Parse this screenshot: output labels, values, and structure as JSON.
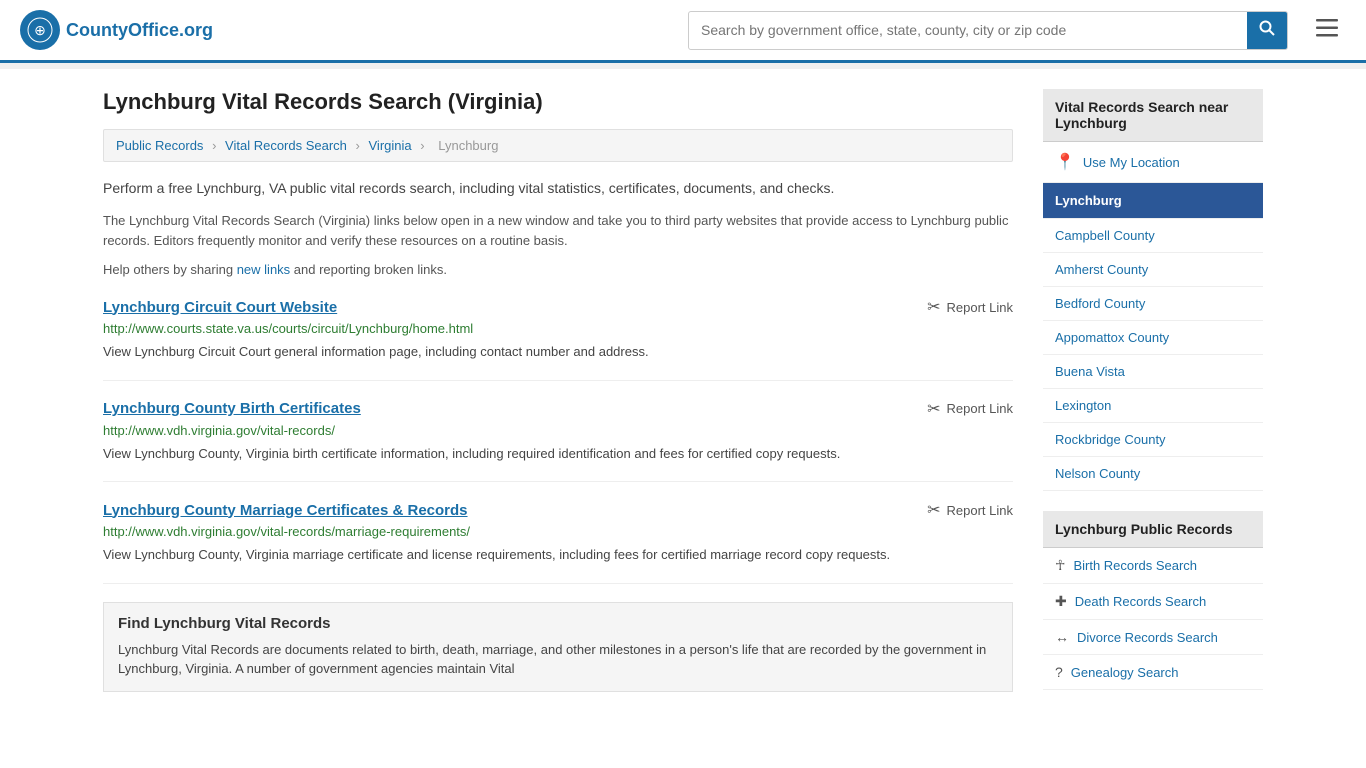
{
  "header": {
    "logo_text": "CountyOffice",
    "logo_org": ".org",
    "search_placeholder": "Search by government office, state, county, city or zip code"
  },
  "page": {
    "title": "Lynchburg Vital Records Search (Virginia)",
    "breadcrumb": {
      "items": [
        "Public Records",
        "Vital Records Search",
        "Virginia",
        "Lynchburg"
      ]
    },
    "intro": "Perform a free Lynchburg, VA public vital records search, including vital statistics, certificates, documents, and checks.",
    "disclaimer": "The Lynchburg Vital Records Search (Virginia) links below open in a new window and take you to third party websites that provide access to Lynchburg public records. Editors frequently monitor and verify these resources on a routine basis.",
    "share_text": "Help others by sharing",
    "share_link": "new links",
    "share_suffix": "and reporting broken links.",
    "results": [
      {
        "title": "Lynchburg Circuit Court Website",
        "url": "http://www.courts.state.va.us/courts/circuit/Lynchburg/home.html",
        "desc": "View Lynchburg Circuit Court general information page, including contact number and address.",
        "report_label": "Report Link"
      },
      {
        "title": "Lynchburg County Birth Certificates",
        "url": "http://www.vdh.virginia.gov/vital-records/",
        "desc": "View Lynchburg County, Virginia birth certificate information, including required identification and fees for certified copy requests.",
        "report_label": "Report Link"
      },
      {
        "title": "Lynchburg County Marriage Certificates & Records",
        "url": "http://www.vdh.virginia.gov/vital-records/marriage-requirements/",
        "desc": "View Lynchburg County, Virginia marriage certificate and license requirements, including fees for certified marriage record copy requests.",
        "report_label": "Report Link"
      }
    ],
    "find_section": {
      "title": "Find Lynchburg Vital Records",
      "desc": "Lynchburg Vital Records are documents related to birth, death, marriage, and other milestones in a person's life that are recorded by the government in Lynchburg, Virginia. A number of government agencies maintain Vital"
    }
  },
  "sidebar": {
    "nearby_header": "Vital Records Search near Lynchburg",
    "location_btn": "Use My Location",
    "active_item": "Lynchburg",
    "nearby_items": [
      "Campbell County",
      "Amherst County",
      "Bedford County",
      "Appomattox County",
      "Buena Vista",
      "Lexington",
      "Rockbridge County",
      "Nelson County"
    ],
    "public_records_header": "Lynchburg Public Records",
    "records": [
      {
        "icon": "☥",
        "label": "Birth Records Search"
      },
      {
        "icon": "+",
        "label": "Death Records Search"
      },
      {
        "icon": "↔",
        "label": "Divorce Records Search"
      },
      {
        "icon": "?",
        "label": "Genealogy Search"
      }
    ]
  }
}
